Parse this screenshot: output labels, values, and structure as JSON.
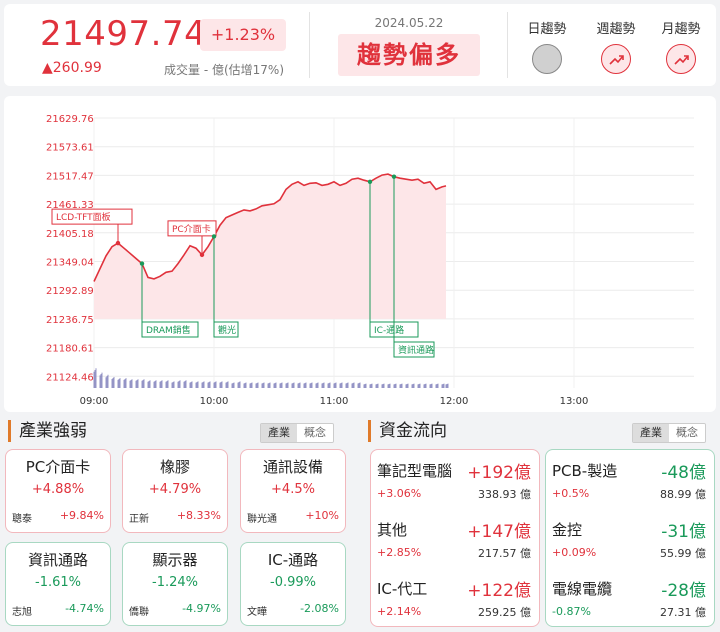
{
  "header": {
    "price": "21497.74",
    "change_pct": "+1.23%",
    "change_pts": "▲260.99",
    "volume": "成交量 - 億(估增17%)",
    "date": "2024.05.22",
    "trend_text": "趨勢偏多",
    "trends": [
      {
        "label": "日趨勢",
        "state": "neutral"
      },
      {
        "label": "週趨勢",
        "state": "up"
      },
      {
        "label": "月趨勢",
        "state": "up"
      }
    ]
  },
  "chart_data": {
    "type": "area",
    "y_ticks": [
      "21629.76",
      "21573.61",
      "21517.47",
      "21461.33",
      "21405.18",
      "21349.04",
      "21292.89",
      "21236.75",
      "21180.61",
      "21124.46"
    ],
    "x_ticks": [
      "09:00",
      "10:00",
      "11:00",
      "12:00",
      "13:00"
    ],
    "ylim": [
      21124.46,
      21629.76
    ],
    "baseline": 21236.75,
    "x": [
      0,
      3,
      6,
      9,
      12,
      15,
      18,
      21,
      24,
      27,
      30,
      33,
      36,
      39,
      42,
      45,
      48,
      51,
      54,
      57,
      60,
      63,
      66,
      69,
      72,
      75,
      78,
      81,
      84,
      87,
      90,
      93,
      96,
      99,
      102,
      105,
      108,
      111,
      114,
      117,
      120,
      123,
      126,
      129,
      132,
      135,
      138,
      141,
      144,
      147,
      150,
      153,
      156,
      159,
      162,
      165,
      168,
      171,
      174,
      176
    ],
    "values": [
      21310,
      21335,
      21360,
      21378,
      21385,
      21375,
      21365,
      21355,
      21345,
      21318,
      21315,
      21320,
      21328,
      21330,
      21345,
      21362,
      21380,
      21375,
      21362,
      21378,
      21398,
      21420,
      21435,
      21440,
      21445,
      21450,
      21448,
      21452,
      21458,
      21460,
      21462,
      21470,
      21490,
      21500,
      21505,
      21498,
      21502,
      21503,
      21498,
      21500,
      21505,
      21498,
      21502,
      21510,
      21512,
      21508,
      21505,
      21512,
      21518,
      21520,
      21515,
      21512,
      21510,
      21508,
      21510,
      21502,
      21505,
      21490,
      21495,
      21497
    ],
    "volume": [
      18,
      14,
      12,
      10,
      9,
      9,
      8,
      8,
      8,
      7,
      7,
      7,
      7,
      6,
      7,
      7,
      6,
      6,
      6,
      6,
      6,
      6,
      6,
      5,
      6,
      5,
      5,
      5,
      5,
      5,
      5,
      5,
      5,
      5,
      5,
      5,
      5,
      5,
      5,
      5,
      5,
      5,
      5,
      5,
      5,
      4,
      4,
      4,
      4,
      4,
      4,
      4,
      4,
      4,
      4,
      4,
      4,
      4,
      4,
      4
    ],
    "annotations": [
      {
        "label": "LCD-TFT面板",
        "x": 12,
        "value": 21385,
        "side": "above"
      },
      {
        "label": "DRAM銷售",
        "x": 24,
        "value": 21345,
        "side": "below"
      },
      {
        "label": "PC介面卡",
        "x": 54,
        "value": 21362,
        "side": "above"
      },
      {
        "label": "觀光",
        "x": 60,
        "value": 21398,
        "side": "below"
      },
      {
        "label": "IC-通路",
        "x": 138,
        "value": 21505,
        "side": "below"
      },
      {
        "label": "資訊通路",
        "x": 150,
        "value": 21515,
        "side": "below2"
      }
    ]
  },
  "industry": {
    "title": "產業強弱",
    "toggle": [
      "產業",
      "概念"
    ],
    "boxes": [
      {
        "name": "PC介面卡",
        "pct": "+4.88%",
        "stock": "聰泰",
        "stock_pct": "+9.84%",
        "dir": "up"
      },
      {
        "name": "橡膠",
        "pct": "+4.79%",
        "stock": "正新",
        "stock_pct": "+8.33%",
        "dir": "up"
      },
      {
        "name": "通訊設備",
        "pct": "+4.5%",
        "stock": "聯光通",
        "stock_pct": "+10%",
        "dir": "up"
      },
      {
        "name": "資訊通路",
        "pct": "-1.61%",
        "stock": "志旭",
        "stock_pct": "-4.74%",
        "dir": "down"
      },
      {
        "name": "顯示器",
        "pct": "-1.24%",
        "stock": "僑聯",
        "stock_pct": "-4.97%",
        "dir": "down"
      },
      {
        "name": "IC-通路",
        "pct": "-0.99%",
        "stock": "文曄",
        "stock_pct": "-2.08%",
        "dir": "down"
      }
    ]
  },
  "funds": {
    "title": "資金流向",
    "toggle": [
      "產業",
      "概念"
    ],
    "inflow": [
      {
        "name": "筆記型電腦",
        "amount": "+192億",
        "pct": "+3.06%",
        "value": "338.93 億"
      },
      {
        "name": "其他",
        "amount": "+147億",
        "pct": "+2.85%",
        "value": "217.57 億"
      },
      {
        "name": "IC-代工",
        "amount": "+122億",
        "pct": "+2.14%",
        "value": "259.25 億"
      }
    ],
    "outflow": [
      {
        "name": "PCB-製造",
        "amount": "-48億",
        "pct": "+0.5%",
        "value": "88.99 億"
      },
      {
        "name": "金控",
        "amount": "-31億",
        "pct": "+0.09%",
        "value": "55.99 億"
      },
      {
        "name": "電線電纜",
        "amount": "-28億",
        "pct": "-0.87%",
        "value": "27.31 億"
      }
    ]
  },
  "colors": {
    "up": "#e0323c",
    "down": "#1a9a5a",
    "accent": "#e07a2a"
  }
}
